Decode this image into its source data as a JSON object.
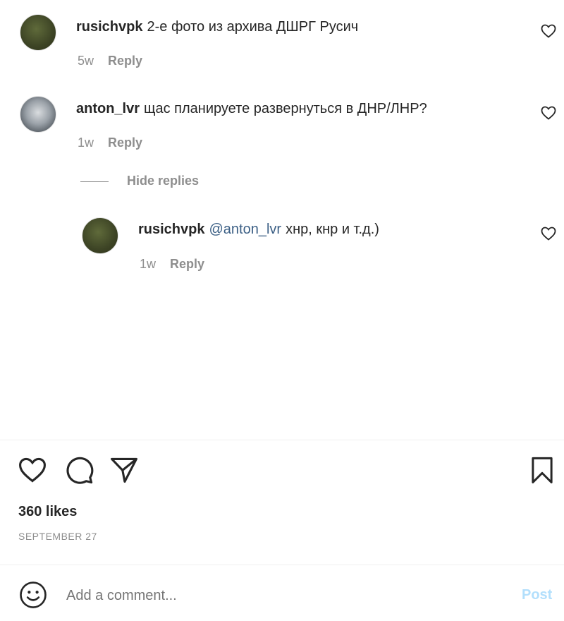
{
  "comments": [
    {
      "username": "rusichvpk",
      "text": "2-е фото из архива ДШРГ Русич",
      "age": "5w",
      "reply_label": "Reply"
    },
    {
      "username": "anton_lvr",
      "text": "щас планируете развернуться в ДНР/ЛНР?",
      "age": "1w",
      "reply_label": "Reply",
      "hide_replies_label": "Hide replies",
      "replies": [
        {
          "username": "rusichvpk",
          "mention": "@anton_lvr",
          "text": "хнр, кнр и т.д.)",
          "age": "1w",
          "reply_label": "Reply"
        }
      ]
    }
  ],
  "post": {
    "likes": "360 likes",
    "date": "SEPTEMBER 27"
  },
  "composer": {
    "placeholder": "Add a comment...",
    "post_label": "Post"
  },
  "icons": {
    "like": "heart-icon",
    "comment": "comment-icon",
    "share": "share-icon",
    "save": "bookmark-icon",
    "emoji": "emoji-icon"
  }
}
